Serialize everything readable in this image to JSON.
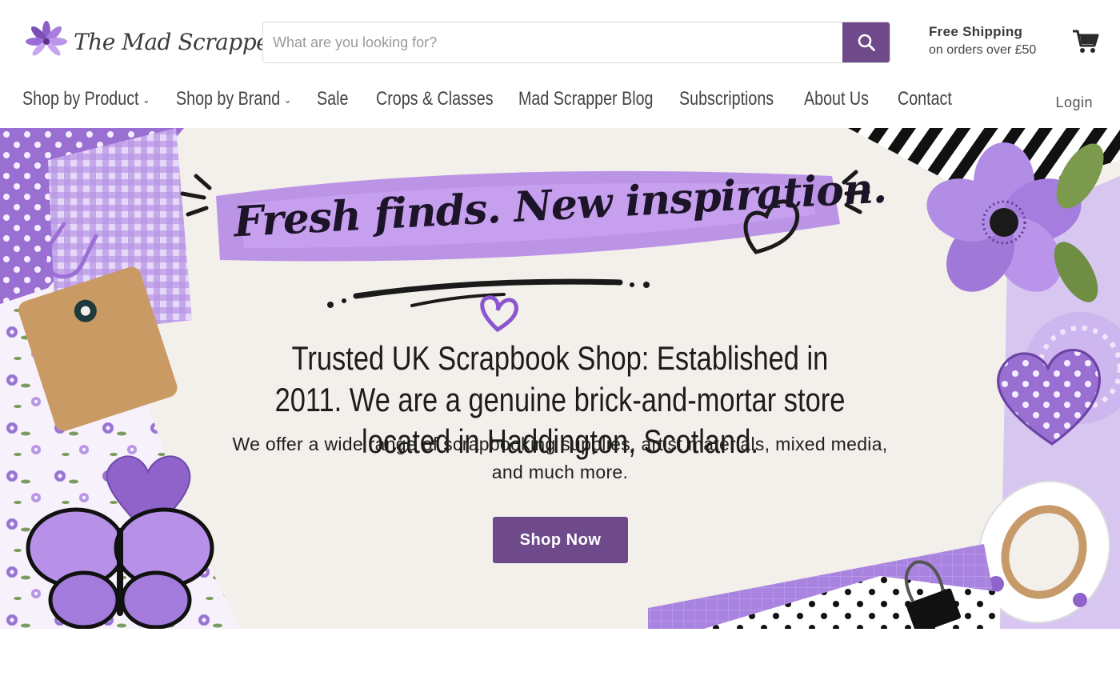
{
  "header": {
    "logo_text": "The Mad Scrapper",
    "search": {
      "placeholder": "What are you looking for?",
      "value": ""
    },
    "shipping": {
      "title": "Free Shipping",
      "subtitle": "on orders over £50"
    }
  },
  "nav": {
    "items": [
      {
        "label": "Shop by Product",
        "has_dropdown": true
      },
      {
        "label": "Shop by Brand",
        "has_dropdown": true
      },
      {
        "label": "Sale"
      },
      {
        "label": "Crops & Classes"
      },
      {
        "label": "Mad Scrapper Blog"
      },
      {
        "label": "Subscriptions"
      },
      {
        "label": "About Us"
      },
      {
        "label": "Contact"
      }
    ],
    "login_label": "Login"
  },
  "hero": {
    "headline": "Fresh finds. New inspiration.",
    "trusted_text": "Trusted UK Scrapbook Shop: Established in 2011. We are a genuine brick-and-mortar store located in Haddington, Scotland.",
    "offer_text": "We offer a wide range of scrapbooking supplies, artist materials, mixed media, and much more.",
    "cta_label": "Shop Now"
  },
  "colors": {
    "brand_purple": "#6e4a8a",
    "lavender": "#b38ee0",
    "text_dark": "#1c1c1c"
  },
  "icons": [
    "flower-logo-icon",
    "search-icon",
    "cart-icon",
    "chevron-down-icon",
    "heart-icon"
  ]
}
